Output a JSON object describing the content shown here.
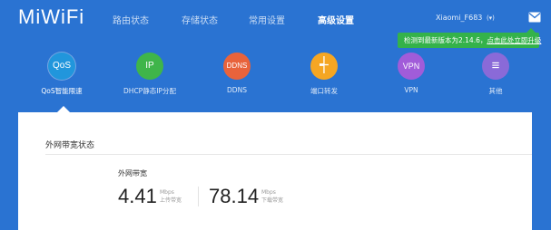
{
  "app": {
    "logo_text": "MiWiFi"
  },
  "nav": {
    "items": [
      {
        "label": "路由状态",
        "active": false
      },
      {
        "label": "存储状态",
        "active": false
      },
      {
        "label": "常用设置",
        "active": false
      },
      {
        "label": "高级设置",
        "active": true
      }
    ]
  },
  "user": {
    "name": "Xiaomi_F683",
    "caret": "(▾)"
  },
  "notice": {
    "text": "检测到最新版本为2.14.6，",
    "link": "点击此处立即升级"
  },
  "tabs": [
    {
      "icon_text": "QoS",
      "label": "QoS智能限速",
      "color": "#2196dc",
      "icon": "qos-icon"
    },
    {
      "icon_text": "IP",
      "label": "DHCP静态IP分配",
      "color": "#3fb54a",
      "icon": "ip-icon"
    },
    {
      "icon_text": "DDNS",
      "label": "DDNS",
      "color": "#e8633b",
      "icon": "ddns-icon"
    },
    {
      "icon_text": "┽",
      "label": "端口转发",
      "color": "#f5a623",
      "icon": "port-forward-icon"
    },
    {
      "icon_text": "VPN",
      "label": "VPN",
      "color": "#a15cd9",
      "icon": "vpn-icon"
    },
    {
      "icon_text": "≡",
      "label": "其他",
      "color": "#8a6ad8",
      "icon": "menu-icon"
    }
  ],
  "panel": {
    "title": "外网带宽状态",
    "bandwidth_label": "外网带宽",
    "upload": {
      "value": "4.41",
      "unit": "Mbps",
      "caption": "上传带宽"
    },
    "download": {
      "value": "78.14",
      "unit": "Mbps",
      "caption": "下载带宽"
    }
  },
  "colors": {
    "background": "#2a73d2",
    "notice": "#34b24a",
    "panel": "#ffffff"
  }
}
